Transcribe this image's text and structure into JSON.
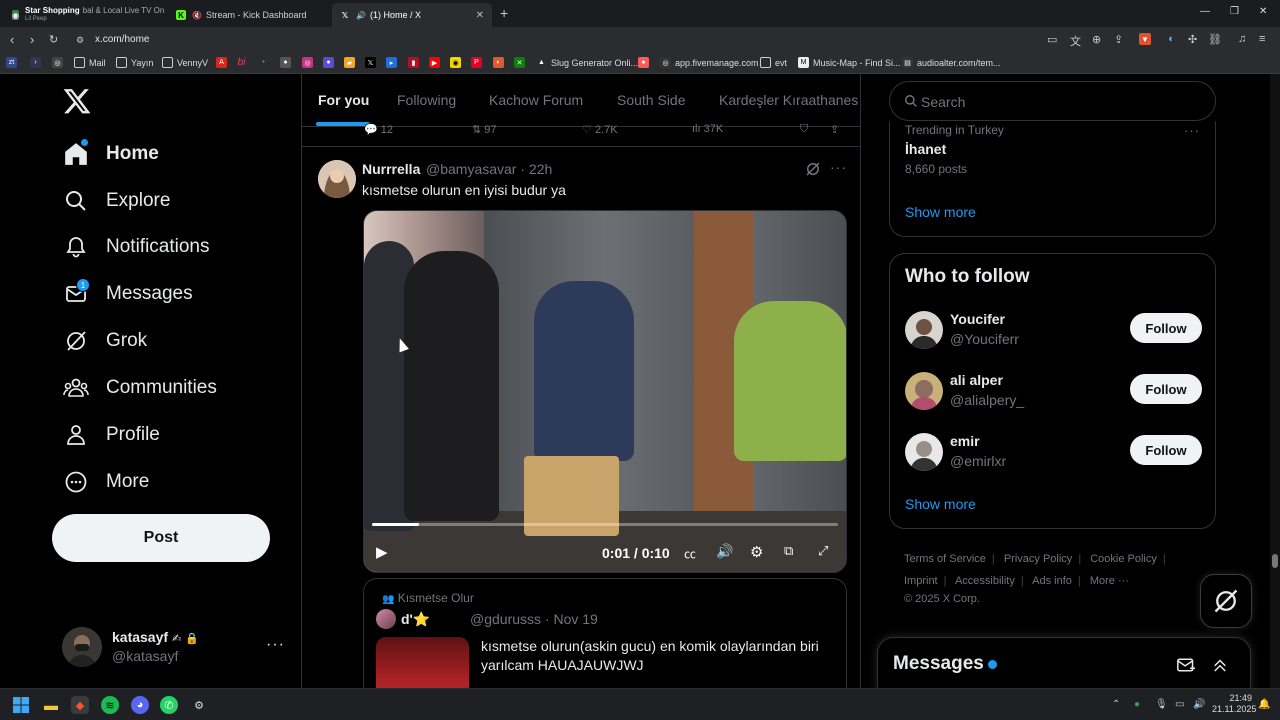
{
  "browser": {
    "tabs": [
      {
        "label": "Star Shopping",
        "sub": "Lil Peep",
        "extra": "bal & Local Live TV On"
      },
      {
        "label": "Stream - Kick Dashboard"
      },
      {
        "label": "(1) Home / X"
      }
    ],
    "url": "x.com/home",
    "bookmarks": [
      "Mail",
      "Yayın",
      "VennyV",
      "Slug Generator Onli...",
      "app.fivemanage.com",
      "evt",
      "Music-Map - Find Si...",
      "audioalter.com/tem..."
    ]
  },
  "nav": {
    "items": [
      {
        "label": "Home",
        "icon": "home-icon"
      },
      {
        "label": "Explore",
        "icon": "search-icon"
      },
      {
        "label": "Notifications",
        "icon": "bell-icon"
      },
      {
        "label": "Messages",
        "icon": "mail-icon",
        "badge": "1"
      },
      {
        "label": "Grok",
        "icon": "grok-icon"
      },
      {
        "label": "Communities",
        "icon": "communities-icon"
      },
      {
        "label": "Profile",
        "icon": "person-icon"
      },
      {
        "label": "More",
        "icon": "more-circle-icon"
      }
    ],
    "post_label": "Post",
    "account": {
      "name": "katasayf",
      "handle": "@katasayf"
    }
  },
  "feed": {
    "tabs": [
      "For you",
      "Following",
      "Kachow Forum",
      "South Side",
      "Kardeşler Kıraathanes"
    ],
    "active_tab": "For you",
    "prev_actions": {
      "replies": "12",
      "reposts": "97",
      "likes": "2.7K",
      "views": "37K"
    },
    "post": {
      "name": "Nurrrella",
      "handle": "@bamyasavar",
      "time": "22h",
      "text": "kısmetse olurun en iyisi budur ya",
      "video": {
        "time": "0:01 / 0:10",
        "progress": 0.1
      },
      "quote": {
        "community": "Kısmetse Olur",
        "name": "d'⭐",
        "handle": "@gdurusss",
        "date": "Nov 19",
        "text": "kısmetse olurun(askin gucu) en komik olaylarından biri yarılcam HAUAJAUWJWJ"
      }
    }
  },
  "right": {
    "search_placeholder": "Search",
    "trend": {
      "context": "Trending in Turkey",
      "name": "İhanet",
      "count": "8,660 posts"
    },
    "show_more": "Show more",
    "who_to_follow": {
      "title": "Who to follow",
      "users": [
        {
          "name": "Youcifer",
          "handle": "@Youciferr",
          "button": "Follow"
        },
        {
          "name": "ali alper",
          "handle": "@alialpery_",
          "button": "Follow"
        },
        {
          "name": "emir",
          "handle": "@emirlxr",
          "button": "Follow"
        }
      ],
      "show_more": "Show more"
    },
    "footer": [
      "Terms of Service",
      "Privacy Policy",
      "Cookie Policy",
      "Imprint",
      "Accessibility",
      "Ads info",
      "More ···",
      "© 2025 X Corp."
    ],
    "messages_title": "Messages"
  },
  "taskbar": {
    "time": "21:49",
    "date": "21.11.2025"
  },
  "colors": {
    "accent": "#1d9bf0",
    "background": "#000000",
    "text": "#e7e9ea",
    "muted": "#71767b"
  }
}
